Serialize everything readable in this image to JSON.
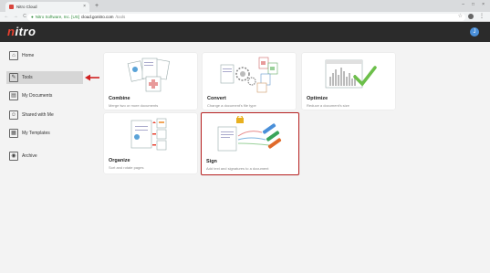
{
  "browser": {
    "tab_title": "Nitro Cloud",
    "tab_close": "×",
    "new_tab": "+",
    "window_controls": [
      "–",
      "□",
      "×"
    ],
    "nav": {
      "back": "←",
      "forward": "→",
      "reload": "C"
    },
    "site_identity": "Nitro Software, Inc. [US]",
    "url": "cloud.gonitro.com",
    "url_path": "/tools",
    "menu": "⋮",
    "star": "☆"
  },
  "app": {
    "logo_mark": "n",
    "logo_text": "itro",
    "avatar_initial": "J"
  },
  "sidebar": {
    "items": [
      {
        "label": "Home",
        "icon": "home-icon",
        "glyph": "⌂",
        "active": false
      },
      {
        "label": "Tools",
        "icon": "tools-icon",
        "glyph": "✎",
        "active": true
      },
      {
        "label": "My Documents",
        "icon": "documents-icon",
        "glyph": "▤",
        "active": false
      },
      {
        "label": "Shared with Me",
        "icon": "shared-icon",
        "glyph": "☺",
        "active": false
      },
      {
        "label": "My Templates",
        "icon": "templates-icon",
        "glyph": "▦",
        "active": false
      },
      {
        "label": "Archive",
        "icon": "archive-icon",
        "glyph": "◉",
        "active": false
      }
    ]
  },
  "tools": {
    "cards": [
      {
        "title": "Combine",
        "subtitle": "Merge two or more documents"
      },
      {
        "title": "Convert",
        "subtitle": "Change a document's file type"
      },
      {
        "title": "Optimize",
        "subtitle": "Reduce a document's size"
      },
      {
        "title": "Organize",
        "subtitle": "Sort and rotate pages"
      },
      {
        "title": "Sign",
        "subtitle": "Add text and signatures to a document"
      }
    ]
  },
  "colors": {
    "accent": "#e8402f",
    "highlight_border": "#b82222",
    "header_bg": "#2b2b2b",
    "avatar": "#4a8fd9"
  }
}
